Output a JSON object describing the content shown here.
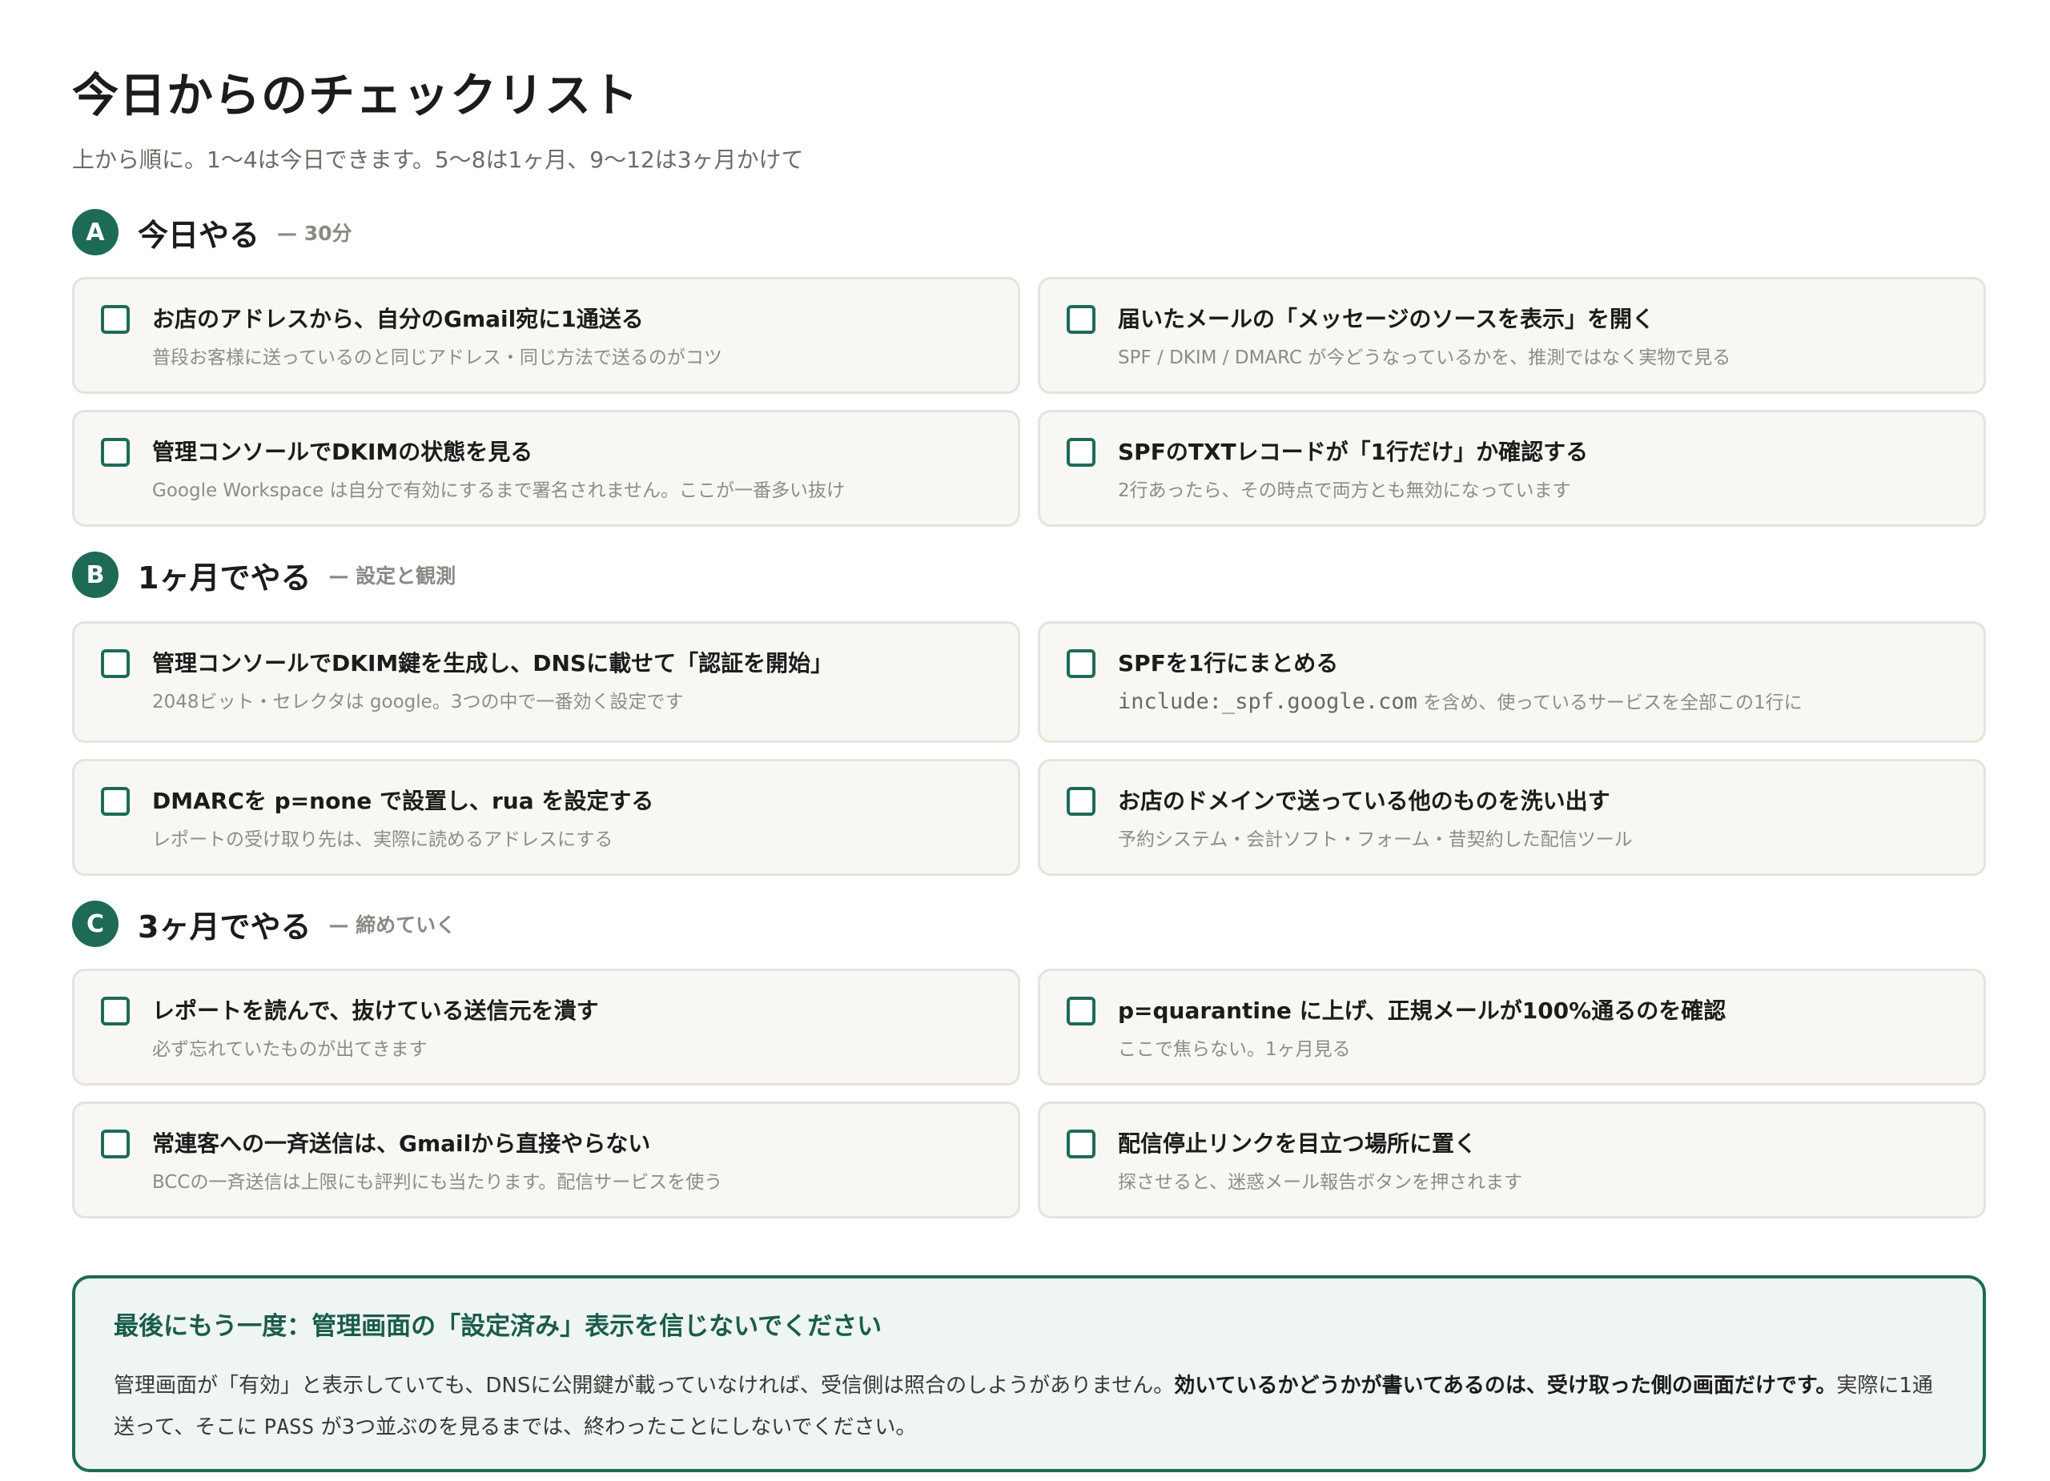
{
  "header": {
    "title": "今日からのチェックリスト",
    "subtitle": "上から順に。1〜4は今日できます。5〜8は1ヶ月、9〜12は3ヶ月かけて"
  },
  "sections": [
    {
      "badge": "A",
      "title": "今日やる",
      "note": "— 30分",
      "items": [
        {
          "title": "お店のアドレスから、自分のGmail宛に1通送る",
          "desc": "普段お客様に送っているのと同じアドレス・同じ方法で送るのがコツ"
        },
        {
          "title": "届いたメールの「メッセージのソースを表示」を開く",
          "desc": "SPF / DKIM / DMARC が今どうなっているかを、推測ではなく実物で見る"
        },
        {
          "title": "管理コンソールでDKIMの状態を見る",
          "desc": "Google Workspace は自分で有効にするまで署名されません。ここが一番多い抜け"
        },
        {
          "title": "SPFのTXTレコードが「1行だけ」か確認する",
          "desc": "2行あったら、その時点で両方とも無効になっています"
        }
      ]
    },
    {
      "badge": "B",
      "title": "1ヶ月でやる",
      "note": "— 設定と観測",
      "items": [
        {
          "title": "管理コンソールでDKIM鍵を生成し、DNSに載せて「認証を開始」",
          "desc": "2048ビット・セレクタは google。3つの中で一番効く設定です"
        },
        {
          "title": "SPFを1行にまとめる",
          "desc_code": "include:_spf.google.com",
          "desc": "を含め、使っているサービスを全部この1行に"
        },
        {
          "title": "DMARCを p=none で設置し、rua を設定する",
          "desc": "レポートの受け取り先は、実際に読めるアドレスにする"
        },
        {
          "title": "お店のドメインで送っている他のものを洗い出す",
          "desc": "予約システム・会計ソフト・フォーム・昔契約した配信ツール"
        }
      ]
    },
    {
      "badge": "C",
      "title": "3ヶ月でやる",
      "note": "— 締めていく",
      "items": [
        {
          "title": "レポートを読んで、抜けている送信元を潰す",
          "desc": "必ず忘れていたものが出てきます"
        },
        {
          "title": "p=quarantine に上げ、正規メールが100%通るのを確認",
          "desc": "ここで焦らない。1ヶ月見る"
        },
        {
          "title": "常連客への一斉送信は、Gmailから直接やらない",
          "desc": "BCCの一斉送信は上限にも評判にも当たります。配信サービスを使う"
        },
        {
          "title": "配信停止リンクを目立つ場所に置く",
          "desc": "探させると、迷惑メール報告ボタンを押されます"
        }
      ]
    }
  ],
  "callout": {
    "title": "最後にもう一度：管理画面の「設定済み」表示を信じないでください",
    "body_1": "管理画面が「有効」と表示していても、DNSに公開鍵が載っていなければ、受信側は照合のしようがありません。",
    "body_strong": "効いているかどうかが書いてあるのは、受け取った側の画面だけです。",
    "body_2": "実際に1通送って、そこに",
    "body_code": "PASS",
    "body_3": "が3つ並ぶのを見るまでは、終わったことにしないでください。"
  },
  "colors": {
    "accent": "#1d6b57",
    "card_bg": "#f8f7f4",
    "card_border": "#e6e3dc",
    "callout_bg": "#eef5f2"
  }
}
